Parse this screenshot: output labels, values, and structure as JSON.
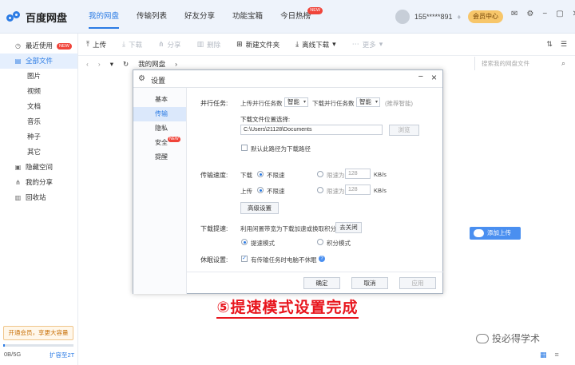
{
  "app": {
    "logo_text": "百度网盘",
    "nav": [
      {
        "label": "我的网盘",
        "active": true
      },
      {
        "label": "传输列表"
      },
      {
        "label": "好友分享"
      },
      {
        "label": "功能宝箱"
      },
      {
        "label": "今日热榜",
        "badge": "NEW"
      }
    ],
    "username": "155*****891",
    "vip_button": "会员中心"
  },
  "sidebar": {
    "items": [
      {
        "label": "最近使用",
        "icon": "clock-icon",
        "badge": "NEW"
      },
      {
        "label": "全部文件",
        "icon": "file-icon",
        "active": true
      },
      {
        "label": "图片",
        "sub": true
      },
      {
        "label": "视频",
        "sub": true
      },
      {
        "label": "文档",
        "sub": true
      },
      {
        "label": "音乐",
        "sub": true
      },
      {
        "label": "种子",
        "sub": true
      },
      {
        "label": "其它",
        "sub": true
      },
      {
        "label": "隐藏空间",
        "icon": "lock-icon"
      },
      {
        "label": "我的分享",
        "icon": "share-icon"
      },
      {
        "label": "回收站",
        "icon": "trash-icon"
      }
    ],
    "promo": "开通会员，享更大容量",
    "quota": "0B/5G",
    "quota_fraction": 0.02,
    "expand": "扩容至2T"
  },
  "toolbar": {
    "upload": "上传",
    "download": "下载",
    "share": "分享",
    "delete": "删除",
    "new_folder": "新建文件夹",
    "offline_download": "离线下载",
    "more": "更多"
  },
  "address": {
    "crumb": "我的网盘",
    "search_placeholder": "搜索我的网盘文件"
  },
  "float_button": "添加上传",
  "caption": "⑤提速模式设置完成",
  "watermark": "投必得学术",
  "dialog": {
    "title": "设置",
    "nav": [
      {
        "label": "基本"
      },
      {
        "label": "传输",
        "active": true
      },
      {
        "label": "隐私"
      },
      {
        "label": "安全",
        "badge": "NEW"
      },
      {
        "label": "提醒"
      }
    ],
    "parallel_label": "并行任务:",
    "upload_parallel": "上传并行任务数",
    "upload_parallel_value": "智能",
    "download_parallel": "下载并行任务数",
    "download_parallel_value": "智能",
    "recommend": "(推荐智能)",
    "download_location_title": "下载文件位置选择:",
    "download_path": "C:\\Users\\21128\\Documents",
    "browse": "浏览",
    "default_path": "默认此路径为下载路径",
    "speed_label": "传输速度:",
    "download": "下载",
    "upload": "上传",
    "unlimited": "不限速",
    "limit_to": "限速为",
    "limit_value_down": "128",
    "limit_value_up": "128",
    "unit": "KB/s",
    "advanced": "高级设置",
    "boost_label": "下载提速:",
    "boost_desc": "利用闲置带宽为下载加速或换取积分",
    "learn": "去关闭",
    "boost_mode": "提速模式",
    "points_mode": "积分模式",
    "sleep_label": "休眠设置:",
    "sleep_option": "有传输任务时电脑不休眠",
    "ok": "确定",
    "cancel": "取消",
    "apply": "应用"
  }
}
